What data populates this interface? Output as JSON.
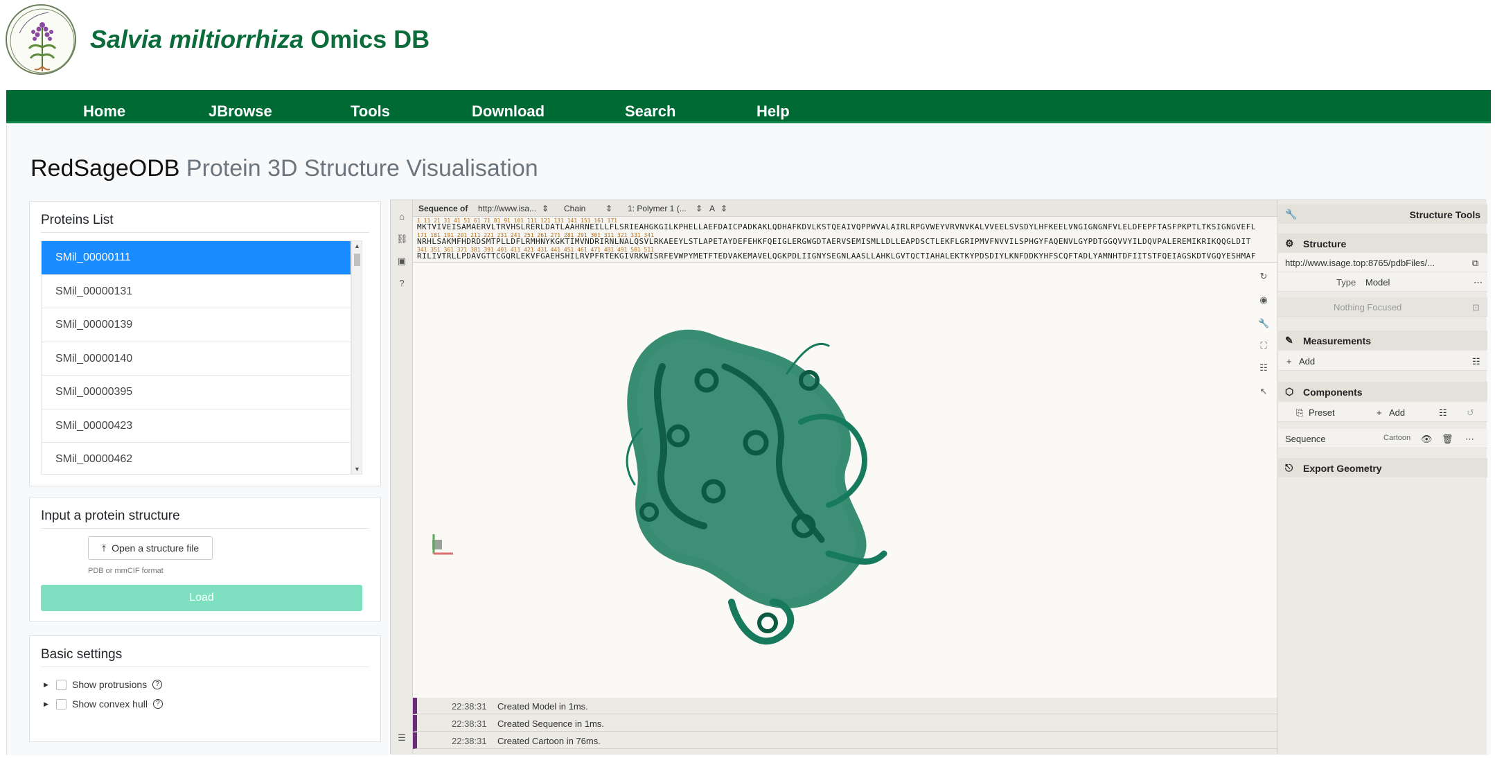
{
  "header": {
    "title_italic": "Salvia miltiorrhiza",
    "title_rest": " Omics DB",
    "logo_icon": "salvia-plant-logo"
  },
  "nav": [
    "Home",
    "JBrowse",
    "Tools",
    "Download",
    "Search",
    "Help"
  ],
  "page": {
    "title_bold": "RedSageODB",
    "title_light": " Protein 3D Structure Visualisation"
  },
  "proteins": {
    "title": "Proteins List",
    "items": [
      "SMil_00000111",
      "SMil_00000131",
      "SMil_00000139",
      "SMil_00000140",
      "SMil_00000395",
      "SMil_00000423",
      "SMil_00000462"
    ],
    "selected_index": 0
  },
  "input": {
    "title": "Input a protein structure",
    "open_label": "Open a structure file",
    "hint": "PDB or mmCIF format",
    "load_label": "Load"
  },
  "settings": {
    "title": "Basic settings",
    "items": [
      "Show protrusions",
      "Show convex hull"
    ]
  },
  "viewer": {
    "seq_header": {
      "label": "Sequence of",
      "source": "http://www.isa...",
      "mode": "Chain",
      "polymer": "1: Polymer 1 (...",
      "chain": "A"
    },
    "seq_lines": [
      "MKTVIVEISAMAERVLTRVHSLRERLDATLAAHRNEILLFLSRIEAHGKGILKPHELLAEFDAICPADKAKLQDHAFKDVLKSTQEAIVQPPWVALAIRLRPGVWEYVRVNVKALVVEELSVSDYLHFKEELVNGIGNGNFVLELDFEPFTASFPKPTLTKSIGNGVEFL",
      "NRHLSAKMFHDRDSMTPLLDFLRMHNYKGKTIMVNDRIRNLNALQSVLRKAEEYLSTLAPETAYDEFEHKFQEIGLERGWGDTAERVSEMISMLLDLLEAPDSCTLEKFLGRIPMVFNVVILSPHGYFAQENVLGYPDTGGQVVYILDQVPALEREMIKRIKQQGLDIT",
      "RILIVTRLLPDAVGTTCGQRLEKVFGAEHSHILRVPFRTEKGIVRKWISRFEVWPYMETFTEDVAKEMAVELQGKPDLIIGNYSEGNLAASLLAHKLGVTQCTIAHALEKTKYPDSDIYLKNFDDKYHFSCQFTADLYAMNHTDFIITSTFQEIAGSKDTVGQYESHMAF"
    ],
    "seq_numbers": [
      "1         11        21        31        41        51        61        71        81        91        101       111       121       131       141       151       161      171",
      "171       181       191       201       211       221       231       241       251       261       271       281       291       301       311       321       331      341",
      "341       351       361       371       381       391       401       411       421       431       441       451       461       471       481       491       501      511"
    ],
    "log": [
      {
        "time": "22:38:31",
        "msg": "Created Model in 1ms."
      },
      {
        "time": "22:38:31",
        "msg": "Created Sequence in 1ms."
      },
      {
        "time": "22:38:31",
        "msg": "Created Cartoon in 76ms."
      }
    ],
    "model_color": "#177a5c"
  },
  "tools": {
    "title": "Structure Tools",
    "structure": "Structure",
    "url": "http://www.isage.top:8765/pdbFiles/...",
    "type_label": "Type",
    "type_value": "Model",
    "focus": "Nothing Focused",
    "measurements": "Measurements",
    "add": "Add",
    "components": "Components",
    "preset": "Preset",
    "sequence": "Sequence",
    "cartoon": "Cartoon",
    "export": "Export Geometry"
  }
}
